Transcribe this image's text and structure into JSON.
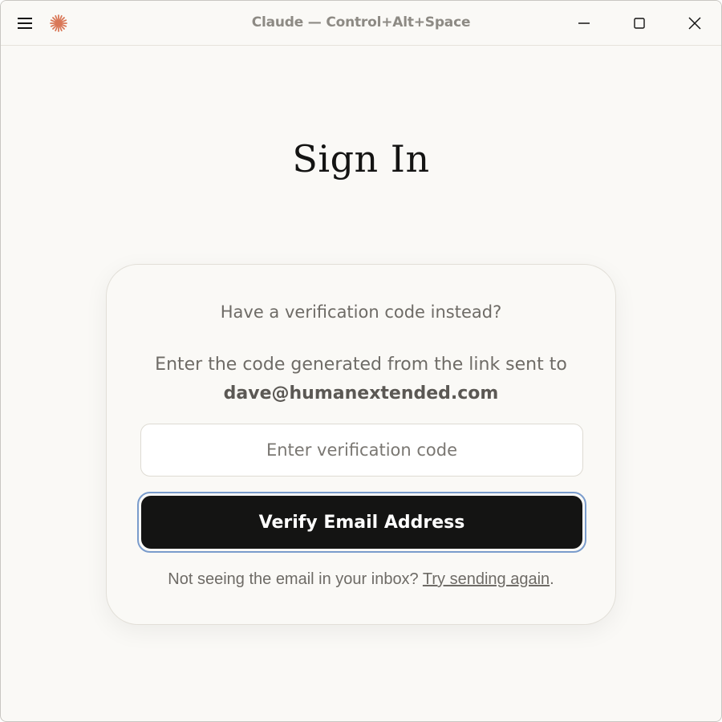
{
  "window": {
    "title": "Claude — Control+Alt+Space",
    "icons": {
      "menu": "hamburger-menu-icon",
      "logo": "claude-asterisk-logo",
      "minimize": "minimize-icon",
      "maximize": "maximize-icon",
      "close": "close-icon"
    }
  },
  "page": {
    "heading": "Sign In"
  },
  "card": {
    "prompt": "Have a verification code instead?",
    "instructions": "Enter the code generated from the link sent to",
    "email": "dave@humanextended.com",
    "code_input": {
      "value": "",
      "placeholder": "Enter verification code"
    },
    "verify_button_label": "Verify Email Address",
    "resend_text": "Not seeing the email in your inbox?",
    "resend_link": "Try sending again",
    "resend_suffix": "."
  },
  "colors": {
    "background": "#faf9f6",
    "button": "#141413",
    "focus_ring": "#7a9ccc",
    "logo": "#d97757"
  }
}
